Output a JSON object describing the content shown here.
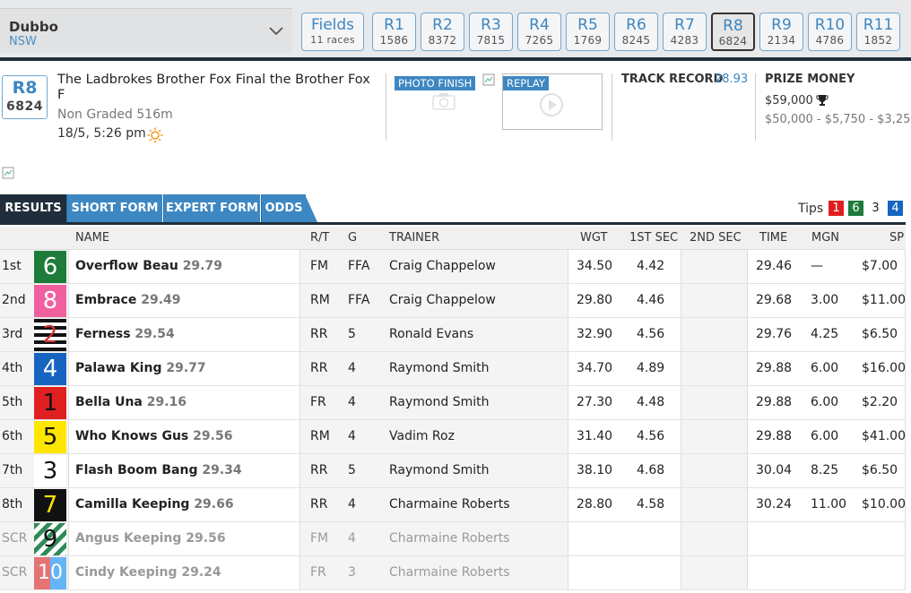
{
  "venue": {
    "name": "Dubbo",
    "state": "NSW"
  },
  "fields": {
    "label": "Fields",
    "sub": "11 races"
  },
  "races": [
    {
      "label": "R1",
      "num": "1586"
    },
    {
      "label": "R2",
      "num": "8372"
    },
    {
      "label": "R3",
      "num": "7815"
    },
    {
      "label": "R4",
      "num": "7265"
    },
    {
      "label": "R5",
      "num": "1769"
    },
    {
      "label": "R6",
      "num": "8245"
    },
    {
      "label": "R7",
      "num": "4283"
    },
    {
      "label": "R8",
      "num": "6824",
      "active": true
    },
    {
      "label": "R9",
      "num": "2134"
    },
    {
      "label": "R10",
      "num": "4786"
    },
    {
      "label": "R11",
      "num": "1852"
    }
  ],
  "race": {
    "badge_label": "R8",
    "badge_num": "6824",
    "title": "The Ladbrokes Brother Fox Final the Brother Fox F",
    "grade": "Non Graded 516m",
    "time": "18/5, 5:26 pm",
    "weather_icon": "sun-icon",
    "photo_finish_label": "PHOTO FINISH",
    "replay_label": "REPLAY",
    "track_record_label": "TRACK RECORD",
    "track_record_value": "28.93",
    "prize_label": "PRIZE MONEY",
    "prize_total": "$59,000",
    "prize_split": "$50,000 - $5,750 - $3,250"
  },
  "tabs": [
    {
      "label": "RESULTS",
      "active": true
    },
    {
      "label": "SHORT FORM"
    },
    {
      "label": "EXPERT FORM"
    },
    {
      "label": "ODDS"
    }
  ],
  "tips": {
    "label": "Tips",
    "boxes": [
      {
        "value": "1",
        "color": "#e02020"
      },
      {
        "value": "6",
        "color": "#1e7b3a"
      },
      {
        "value": "3",
        "color": "#ffffff"
      },
      {
        "value": "4",
        "color": "#1565c0"
      }
    ]
  },
  "columns": {
    "name": "NAME",
    "rt": "R/T",
    "g": "G",
    "trainer": "TRAINER",
    "wgt": "WGT",
    "first_sec": "1ST SEC",
    "second_sec": "2ND SEC",
    "time": "TIME",
    "mgn": "MGN",
    "sp": "SP"
  },
  "results": [
    {
      "pos": "1st",
      "rug": "6",
      "name": "Overflow Beau",
      "rating": "29.79",
      "rt": "FM",
      "g": "FFA",
      "trainer": "Craig Chappelow",
      "wgt": "34.50",
      "first_sec": "4.42",
      "second_sec": "",
      "time": "29.46",
      "mgn": "—",
      "sp": "$7.00"
    },
    {
      "pos": "2nd",
      "rug": "8",
      "name": "Embrace",
      "rating": "29.49",
      "rt": "RM",
      "g": "FFA",
      "trainer": "Craig Chappelow",
      "wgt": "29.80",
      "first_sec": "4.46",
      "second_sec": "",
      "time": "29.68",
      "mgn": "3.00",
      "sp": "$11.00"
    },
    {
      "pos": "3rd",
      "rug": "2",
      "name": "Ferness",
      "rating": "29.54",
      "rt": "RR",
      "g": "5",
      "trainer": "Ronald Evans",
      "wgt": "32.90",
      "first_sec": "4.56",
      "second_sec": "",
      "time": "29.76",
      "mgn": "4.25",
      "sp": "$6.50"
    },
    {
      "pos": "4th",
      "rug": "4",
      "name": "Palawa King",
      "rating": "29.77",
      "rt": "RR",
      "g": "4",
      "trainer": "Raymond Smith",
      "wgt": "34.70",
      "first_sec": "4.89",
      "second_sec": "",
      "time": "29.88",
      "mgn": "6.00",
      "sp": "$16.00"
    },
    {
      "pos": "5th",
      "rug": "1",
      "name": "Bella Una",
      "rating": "29.16",
      "rt": "FR",
      "g": "4",
      "trainer": "Raymond Smith",
      "wgt": "27.30",
      "first_sec": "4.48",
      "second_sec": "",
      "time": "29.88",
      "mgn": "6.00",
      "sp": "$2.20"
    },
    {
      "pos": "6th",
      "rug": "5",
      "name": "Who Knows Gus",
      "rating": "29.56",
      "rt": "RM",
      "g": "4",
      "trainer": "Vadim Roz",
      "wgt": "31.40",
      "first_sec": "4.56",
      "second_sec": "",
      "time": "29.88",
      "mgn": "6.00",
      "sp": "$41.00"
    },
    {
      "pos": "7th",
      "rug": "3",
      "name": "Flash Boom Bang",
      "rating": "29.34",
      "rt": "RR",
      "g": "5",
      "trainer": "Raymond Smith",
      "wgt": "38.10",
      "first_sec": "4.68",
      "second_sec": "",
      "time": "30.04",
      "mgn": "8.25",
      "sp": "$6.50"
    },
    {
      "pos": "8th",
      "rug": "7",
      "name": "Camilla Keeping",
      "rating": "29.66",
      "rt": "RR",
      "g": "4",
      "trainer": "Charmaine Roberts",
      "wgt": "28.80",
      "first_sec": "4.58",
      "second_sec": "",
      "time": "30.24",
      "mgn": "11.00",
      "sp": "$10.00"
    },
    {
      "pos": "SCR",
      "rug": "9",
      "name": "Angus Keeping",
      "rating": "29.56",
      "rt": "FM",
      "g": "4",
      "trainer": "Charmaine Roberts",
      "wgt": "",
      "first_sec": "",
      "second_sec": "",
      "time": "",
      "mgn": "",
      "sp": "",
      "scratched": true
    },
    {
      "pos": "SCR",
      "rug": "10",
      "name": "Cindy Keeping",
      "rating": "29.24",
      "rt": "FR",
      "g": "3",
      "trainer": "Charmaine Roberts",
      "wgt": "",
      "first_sec": "",
      "second_sec": "",
      "time": "",
      "mgn": "",
      "sp": "",
      "scratched": true
    }
  ]
}
